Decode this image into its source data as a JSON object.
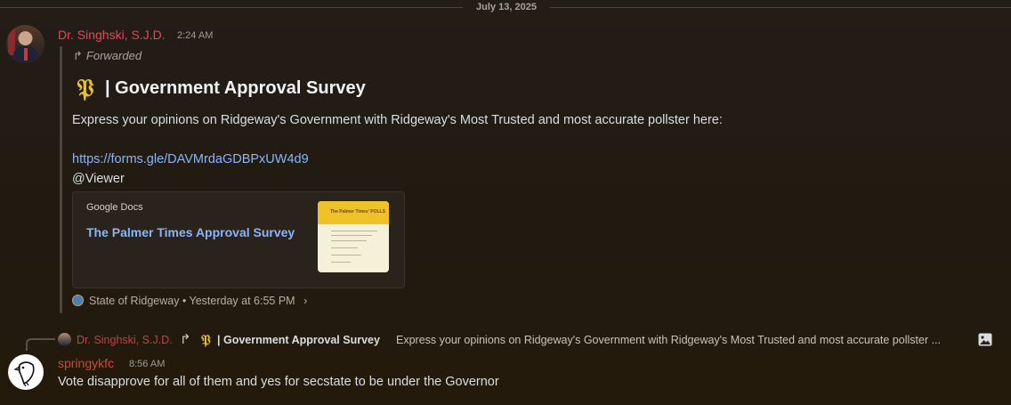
{
  "date_divider": "July 13, 2025",
  "message1": {
    "author": "Dr. Singhski, S.J.D.",
    "time": "2:24 AM",
    "forwarded_label": "Forwarded",
    "title": "| Government Approval Survey",
    "logo_glyph": "𝔓",
    "body": "Express your opinions on Ridgeway's Government with Ridgeway's Most Trusted and most accurate pollster here:",
    "link": "https://forms.gle/DAVMrdaGDBPxUW4d9",
    "mention": "@Viewer",
    "embed": {
      "provider": "Google Docs",
      "title": "The Palmer Times Approval Survey",
      "thumb_header": "The Palmer Times' POLLS"
    },
    "source": "State of Ridgeway • Yesterday at 6:55 PM",
    "source_chevron": "›"
  },
  "reply": {
    "author": "Dr. Singhski, S.J.D.",
    "title": "| Government Approval Survey",
    "preview": "Express your opinions on Ridgeway's Government with Ridgeway's Most Trusted and most accurate pollster ..."
  },
  "message2": {
    "author": "springykfc",
    "time": "8:56 AM",
    "body": "Vote disapprove for all of them and yes for secstate to be under the Governor"
  },
  "colors": {
    "author1": "#e8455a",
    "author2": "#c94a3c",
    "link": "#8ab4f8",
    "logo": "#e8c230"
  },
  "icons": [
    "forward-icon",
    "image-icon",
    "server-icon"
  ]
}
